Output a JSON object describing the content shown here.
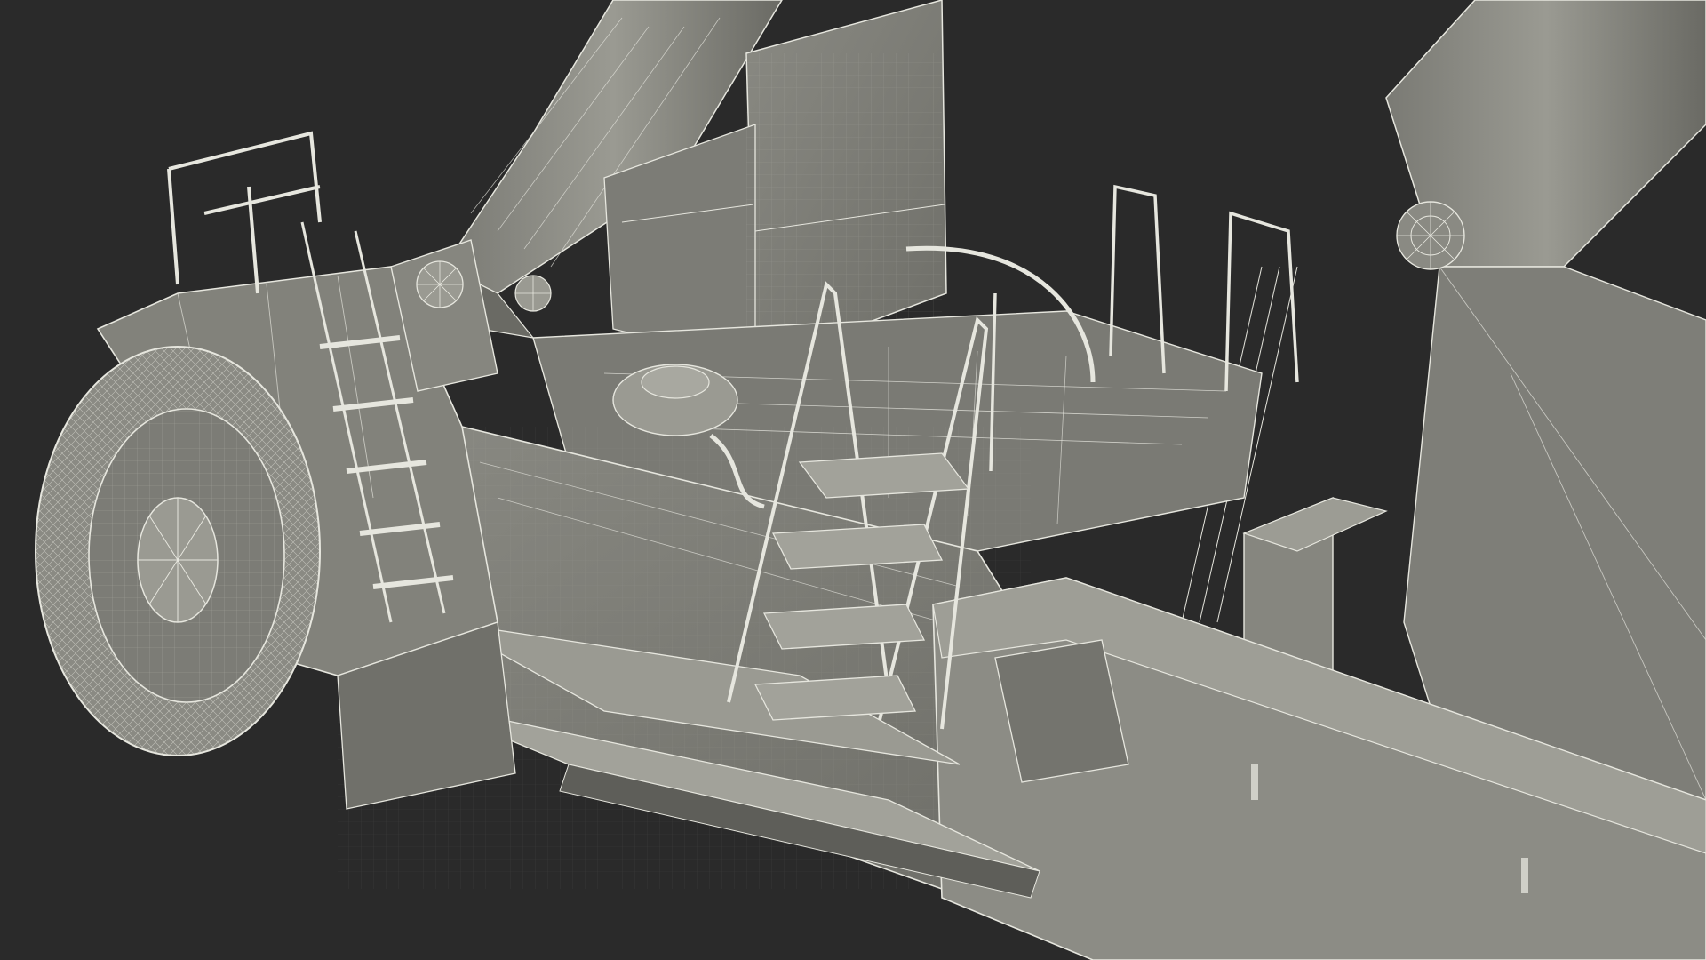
{
  "scene": {
    "subject": "reach-stacker-wireframe",
    "background_color": "#2a2a2a",
    "surface_color": "#8e8e86",
    "surface_shadow_color": "#5c5c57",
    "surface_light_color": "#a6a69e",
    "wire_color": "#e8e8e0"
  }
}
